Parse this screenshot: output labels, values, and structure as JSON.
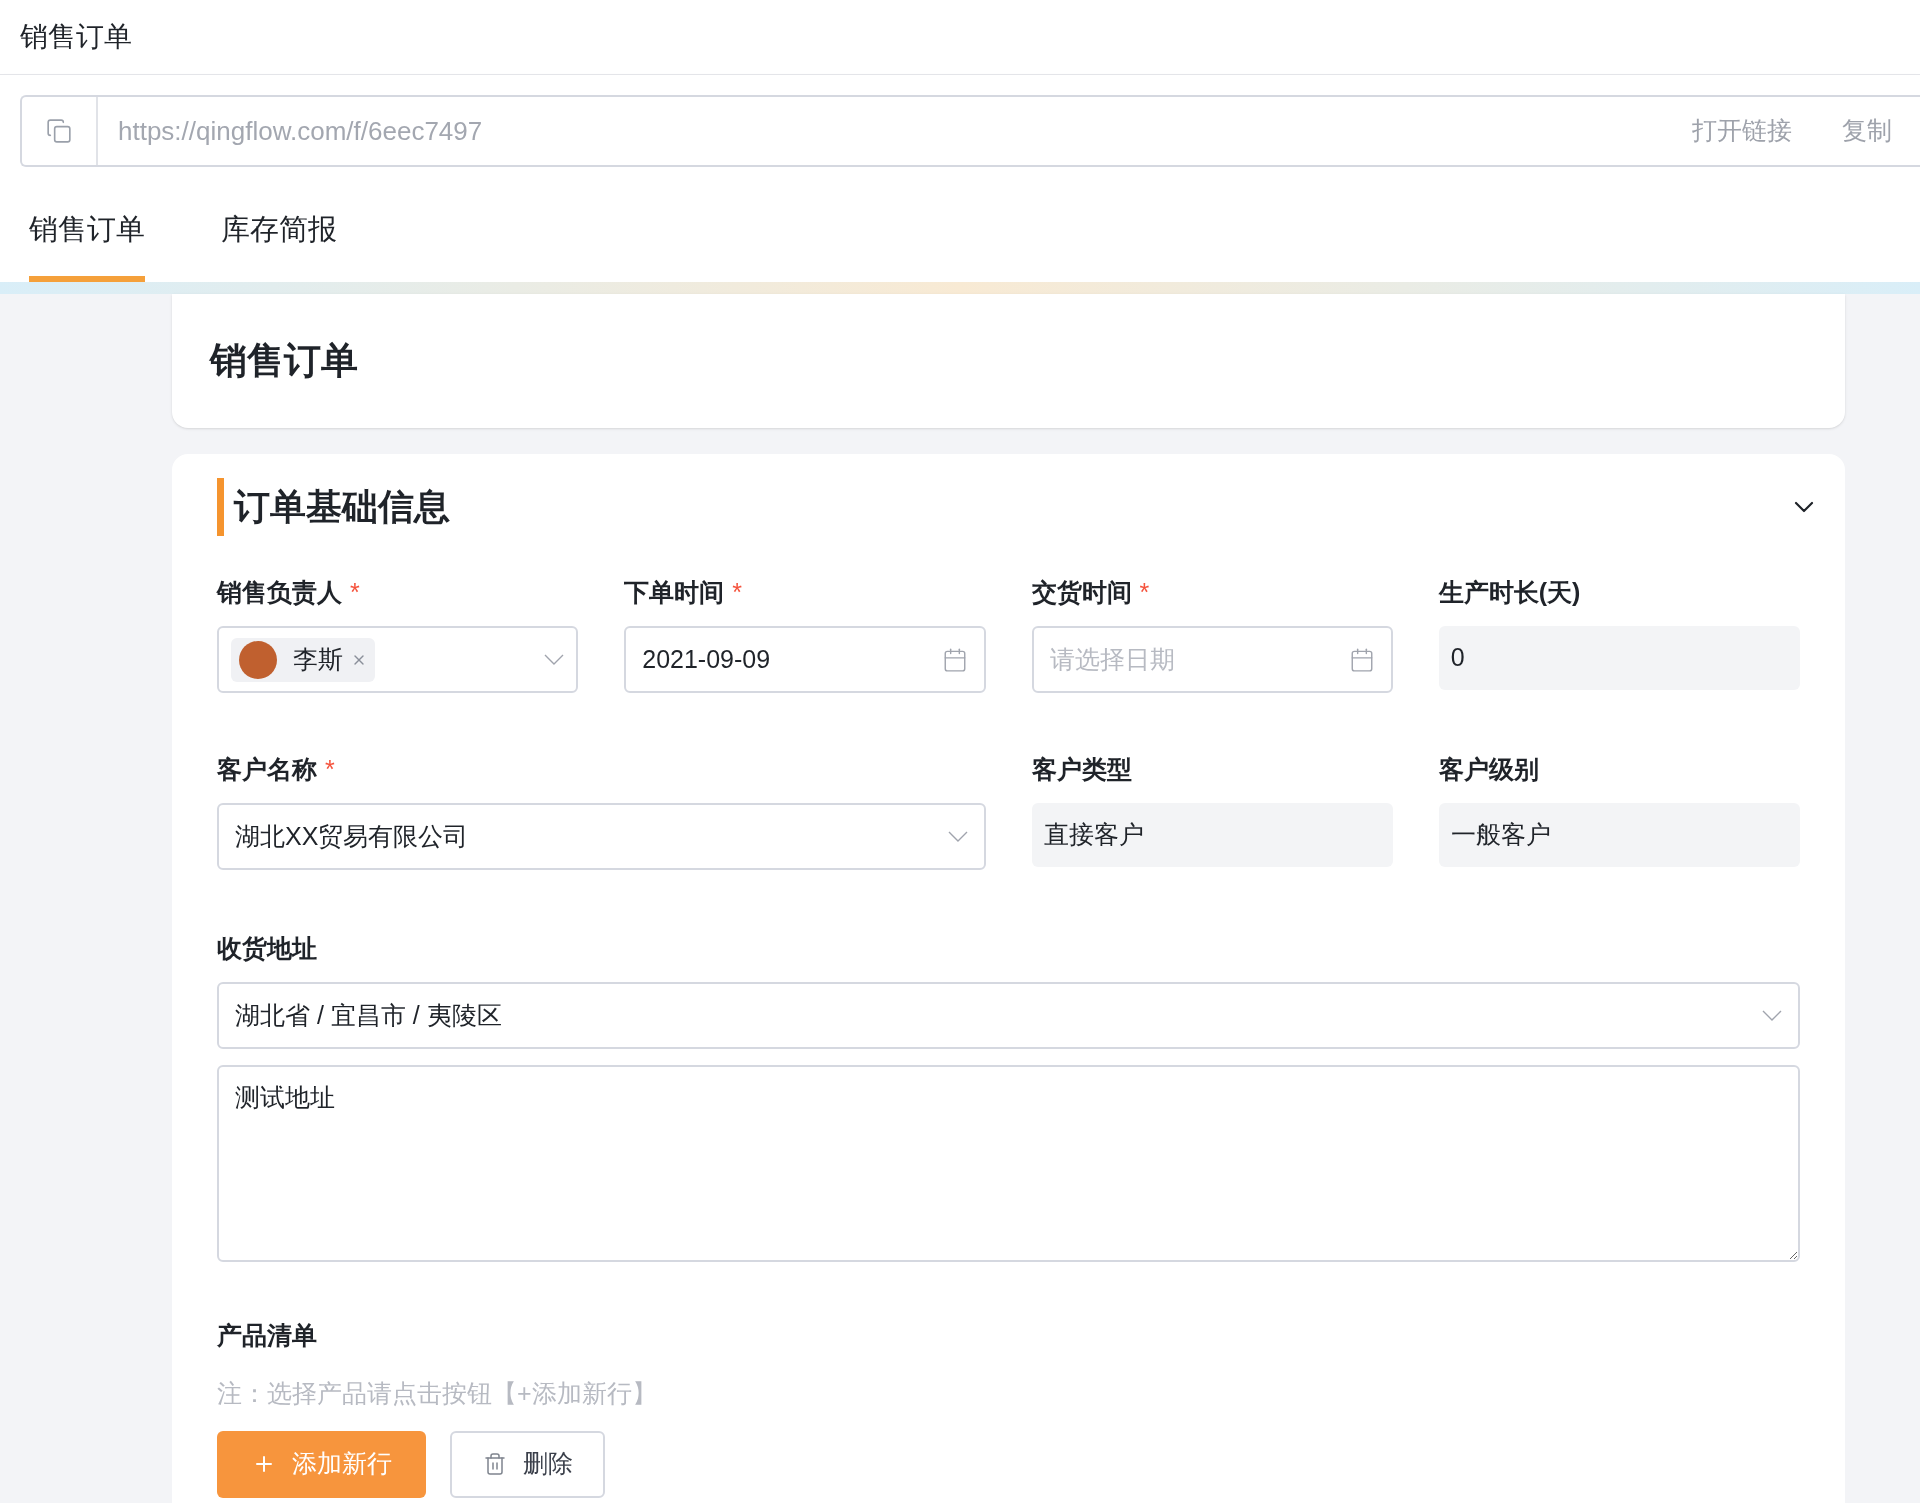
{
  "window": {
    "title": "销售订单"
  },
  "link_bar": {
    "url": "https://qingflow.com/f/6eec7497",
    "actions": [
      "打开链接",
      "复制"
    ]
  },
  "tabs": [
    {
      "label": "销售订单",
      "selected": true
    },
    {
      "label": "库存简报",
      "selected": false
    }
  ],
  "form_title": "销售订单",
  "section": {
    "title": "订单基础信息",
    "expanded": true
  },
  "rows": [
    [
      {
        "kind": "user",
        "label": "销售负责人",
        "required_mark": "*",
        "value": "李斯"
      },
      {
        "kind": "date",
        "label": "下单时间",
        "required_mark": "*",
        "value": "2021-09-09"
      },
      {
        "kind": "date",
        "label": "交货时间",
        "required_mark": "*",
        "placeholder": "请选择日期"
      },
      {
        "kind": "readonly",
        "label": "生产时长(天)",
        "value": "0"
      }
    ],
    [
      {
        "kind": "select",
        "label": "客户名称",
        "required_mark": "*",
        "value": "湖北XX贸易有限公司"
      },
      {
        "kind": "readonly",
        "label": "客户类型",
        "value": "直接客户"
      },
      {
        "kind": "readonly",
        "label": "客户级别",
        "value": "一般客户"
      }
    ]
  ],
  "address": {
    "label": "收货地址",
    "region": "湖北省 / 宜昌市 / 夷陵区",
    "detail": "测试地址"
  },
  "products": {
    "label": "产品清单",
    "note": "注：选择产品请点击按钮【+添加新行】",
    "buttons": [
      {
        "kind": "primary",
        "label": "添加新行"
      },
      {
        "kind": "delete",
        "label": "删除"
      }
    ]
  }
}
